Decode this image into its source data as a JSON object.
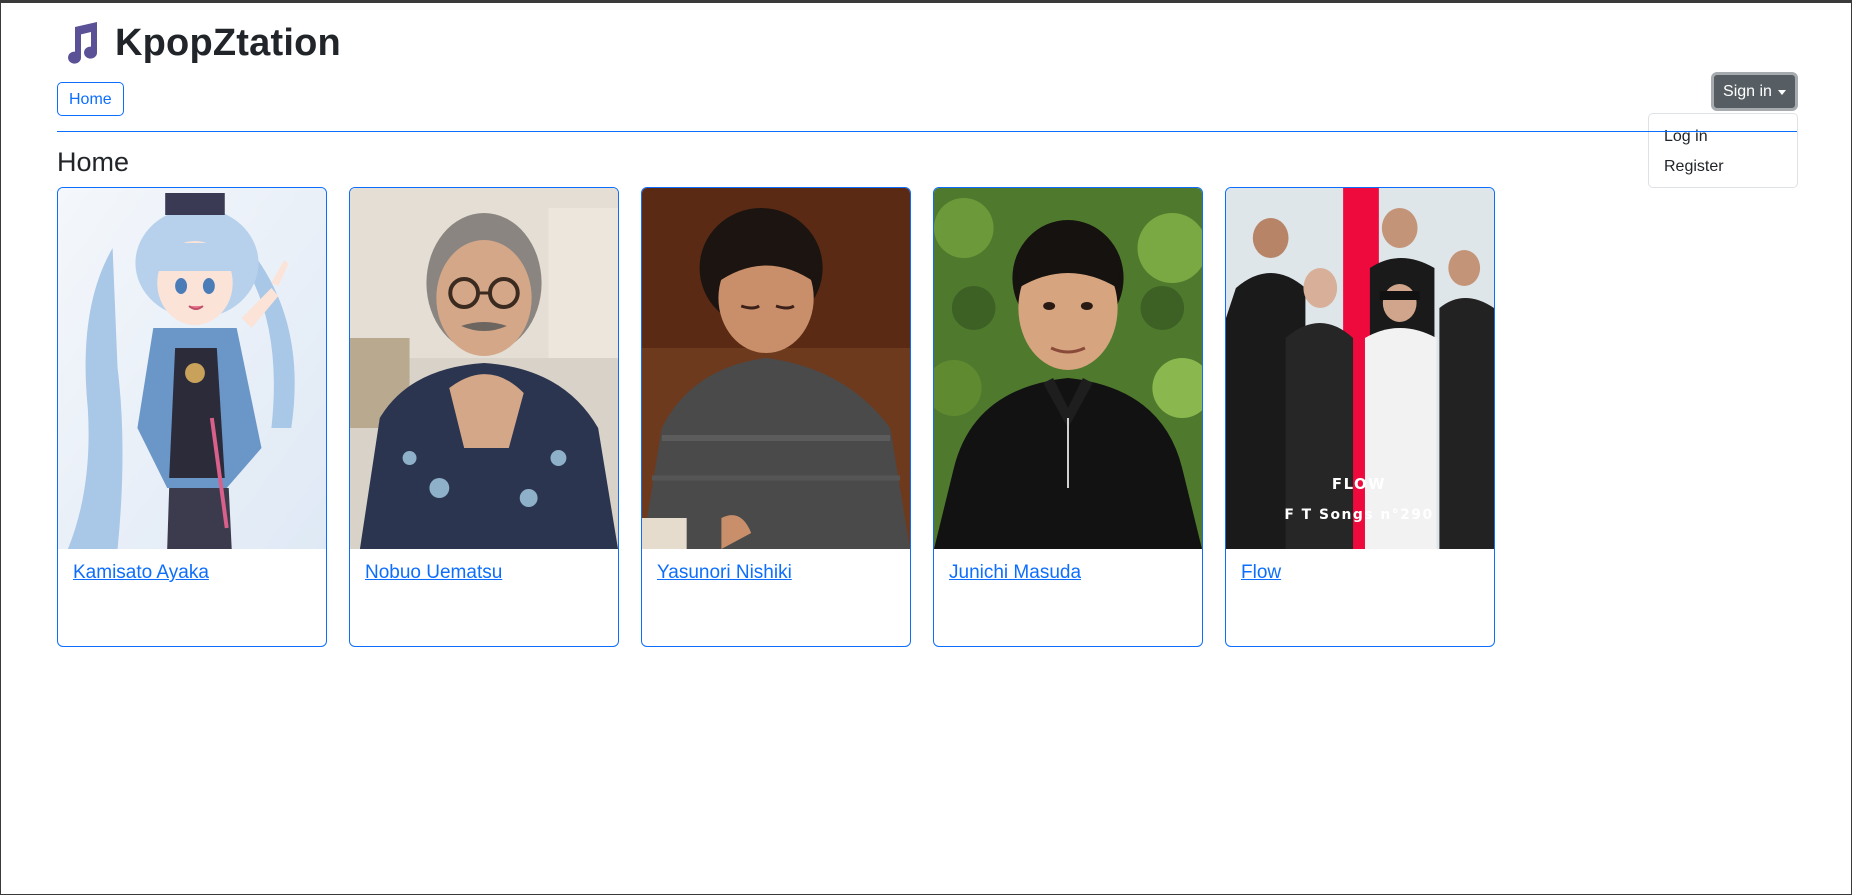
{
  "brand": {
    "title": "KpopZtation",
    "icon": "music-note-icon",
    "icon_color": "#5b5196"
  },
  "nav": {
    "home_label": "Home"
  },
  "auth": {
    "signin_label": "Sign in",
    "menu": [
      "Log in",
      "Register"
    ]
  },
  "page": {
    "title": "Home"
  },
  "artists": [
    {
      "name": "Kamisato Ayaka"
    },
    {
      "name": "Nobuo Uematsu"
    },
    {
      "name": "Yasunori Nishiki"
    },
    {
      "name": "Junichi Masuda"
    },
    {
      "name": "Flow"
    }
  ],
  "flow_cover": {
    "line1": "FLOW",
    "line2": "F  T Songs n°290"
  },
  "colors": {
    "accent": "#0d6efd",
    "signin_bg": "#565e64"
  }
}
